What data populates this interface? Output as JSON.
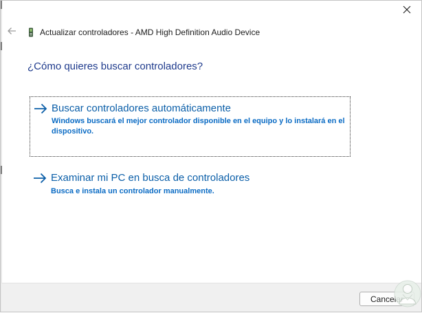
{
  "window": {
    "title": "Actualizar controladores - AMD High Definition Audio Device",
    "close_glyph": "✕"
  },
  "question": "¿Cómo quieres buscar controladores?",
  "options": [
    {
      "title": "Buscar controladores automáticamente",
      "description": "Windows buscará el mejor controlador disponible en el equipo y lo instalará en el dispositivo."
    },
    {
      "title": "Examinar mi PC en busca de controladores",
      "description": "Busca e instala un controlador manualmente."
    }
  ],
  "footer": {
    "cancel_label": "Cancelar"
  },
  "icons": {
    "back": "back-arrow-icon",
    "device": "audio-device-icon",
    "close": "close-icon",
    "option_arrow": "right-arrow-icon",
    "watermark": "watermark-logo"
  },
  "colors": {
    "question": "#1e3a8c",
    "option_title": "#0a5ea8",
    "option_desc": "#0a6bc4",
    "footer_bg": "#f0f0f0"
  }
}
